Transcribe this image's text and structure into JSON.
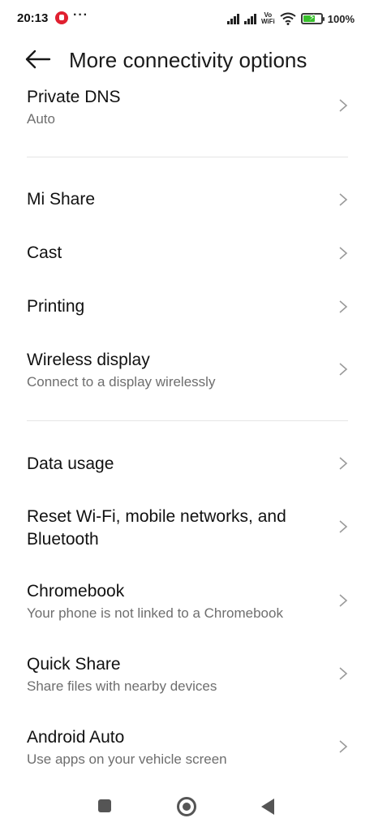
{
  "status_bar": {
    "time": "20:13",
    "more_notifications": "···",
    "volte_top": "Vo",
    "volte_bottom": "WiFi",
    "battery_percent": "100%",
    "battery_level": 0.7,
    "battery_color": "#38c02c"
  },
  "header": {
    "back_icon": "arrow-left-icon",
    "title": "More connectivity options"
  },
  "items": [
    {
      "title": "Private DNS",
      "subtitle": "Auto"
    },
    {
      "title": "Mi Share",
      "subtitle": ""
    },
    {
      "title": "Cast",
      "subtitle": ""
    },
    {
      "title": "Printing",
      "subtitle": ""
    },
    {
      "title": "Wireless display",
      "subtitle": "Connect to a display wirelessly"
    },
    {
      "title": "Data usage",
      "subtitle": ""
    },
    {
      "title": "Reset Wi-Fi, mobile networks, and",
      "title2": "Bluetooth",
      "subtitle": ""
    },
    {
      "title": "Chromebook",
      "subtitle": "Your phone is not linked to a Chromebook"
    },
    {
      "title": "Quick Share",
      "subtitle": "Share files with nearby devices"
    },
    {
      "title": "Android Auto",
      "subtitle": "Use apps on your vehicle screen"
    }
  ],
  "nav": {
    "recents_icon": "square-icon",
    "home_icon": "circle-icon",
    "back_icon": "triangle-back-icon"
  }
}
